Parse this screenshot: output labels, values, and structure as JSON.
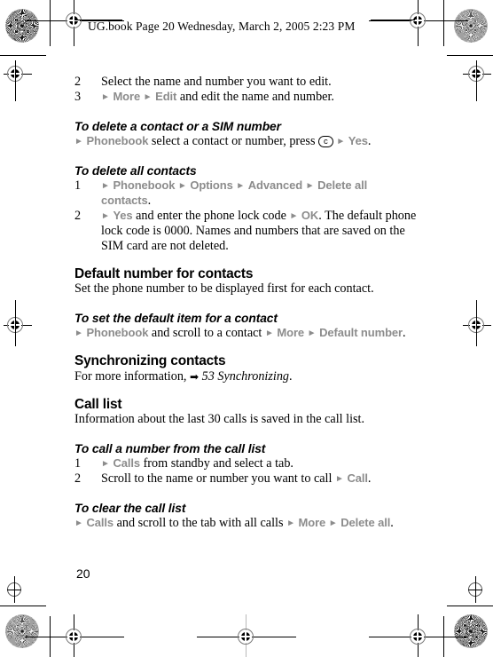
{
  "header": {
    "text": "UG.book  Page 20  Wednesday, March 2, 2005  2:23 PM"
  },
  "colors": {
    "menu_grey": "#8c8c8c",
    "text_black": "#000000",
    "page_background": "#ffffff"
  },
  "icons": {
    "menu_arrow": "►",
    "xref_arrow": "➡",
    "clear_key": "c"
  },
  "content": {
    "steps_edit": [
      {
        "number": "2",
        "segments": [
          {
            "type": "text",
            "value": "Select the name and number you want to edit."
          }
        ]
      },
      {
        "number": "3",
        "segments": [
          {
            "type": "arrow"
          },
          {
            "type": "menu",
            "value": "More"
          },
          {
            "type": "arrow"
          },
          {
            "type": "menu",
            "value": "Edit"
          },
          {
            "type": "text",
            "value": " and edit the name and number."
          }
        ]
      }
    ],
    "delete_contact_heading": "To delete a contact or a SIM number",
    "delete_contact_line": {
      "segments": [
        {
          "type": "arrow"
        },
        {
          "type": "menu",
          "value": "Phonebook"
        },
        {
          "type": "text",
          "value": " select a contact or number, press "
        },
        {
          "type": "keycap",
          "value": "c"
        },
        {
          "type": "text",
          "value": " "
        },
        {
          "type": "arrow"
        },
        {
          "type": "menu",
          "value": "Yes"
        },
        {
          "type": "text",
          "value": "."
        }
      ]
    },
    "delete_all_heading": "To delete all contacts",
    "delete_all_steps": [
      {
        "number": "1",
        "segments": [
          {
            "type": "arrow"
          },
          {
            "type": "menu",
            "value": "Phonebook"
          },
          {
            "type": "text",
            "value": " "
          },
          {
            "type": "arrow"
          },
          {
            "type": "menu",
            "value": "Options"
          },
          {
            "type": "text",
            "value": " "
          },
          {
            "type": "arrow"
          },
          {
            "type": "menu",
            "value": "Advanced"
          },
          {
            "type": "text",
            "value": " "
          },
          {
            "type": "arrow"
          },
          {
            "type": "menu",
            "value": "Delete all contacts"
          },
          {
            "type": "text",
            "value": "."
          }
        ]
      },
      {
        "number": "2",
        "segments": [
          {
            "type": "arrow"
          },
          {
            "type": "menu",
            "value": "Yes"
          },
          {
            "type": "text",
            "value": " and enter the phone lock code "
          },
          {
            "type": "arrow"
          },
          {
            "type": "menu",
            "value": "OK"
          },
          {
            "type": "text",
            "value": ". The default phone lock code is 0000. Names and numbers that are saved on the SIM card are not deleted."
          }
        ]
      }
    ],
    "default_number_heading": "Default number for contacts",
    "default_number_body": "Set the phone number to be displayed first for each contact.",
    "set_default_heading": "To set the default item for a contact",
    "set_default_line": {
      "segments": [
        {
          "type": "arrow"
        },
        {
          "type": "menu",
          "value": "Phonebook"
        },
        {
          "type": "text",
          "value": " and scroll to a contact "
        },
        {
          "type": "arrow"
        },
        {
          "type": "menu",
          "value": "More"
        },
        {
          "type": "text",
          "value": " "
        },
        {
          "type": "arrow"
        },
        {
          "type": "menu",
          "value": "Default number"
        },
        {
          "type": "text",
          "value": "."
        }
      ]
    },
    "sync_heading": "Synchronizing contacts",
    "sync_line": {
      "prefix": "For more information, ",
      "xref": "53 Synchronizing",
      "suffix": "."
    },
    "call_list_heading": "Call list",
    "call_list_body": "Information about the last 30 calls is saved in the call list.",
    "call_from_list_heading": "To call a number from the call list",
    "call_from_list_steps": [
      {
        "number": "1",
        "segments": [
          {
            "type": "arrow"
          },
          {
            "type": "menu",
            "value": "Calls"
          },
          {
            "type": "text",
            "value": " from standby and select a tab."
          }
        ]
      },
      {
        "number": "2",
        "segments": [
          {
            "type": "text",
            "value": "Scroll to the name or number you want to call "
          },
          {
            "type": "arrow"
          },
          {
            "type": "menu",
            "value": "Call"
          },
          {
            "type": "text",
            "value": "."
          }
        ]
      }
    ],
    "clear_call_list_heading": "To clear the call list",
    "clear_call_list_line": {
      "segments": [
        {
          "type": "arrow"
        },
        {
          "type": "menu",
          "value": "Calls"
        },
        {
          "type": "text",
          "value": " and scroll to the tab with all calls "
        },
        {
          "type": "arrow"
        },
        {
          "type": "menu",
          "value": "More"
        },
        {
          "type": "text",
          "value": " "
        },
        {
          "type": "arrow"
        },
        {
          "type": "menu",
          "value": "Delete all"
        },
        {
          "type": "text",
          "value": "."
        }
      ]
    }
  },
  "footer": {
    "page_number": "20"
  }
}
